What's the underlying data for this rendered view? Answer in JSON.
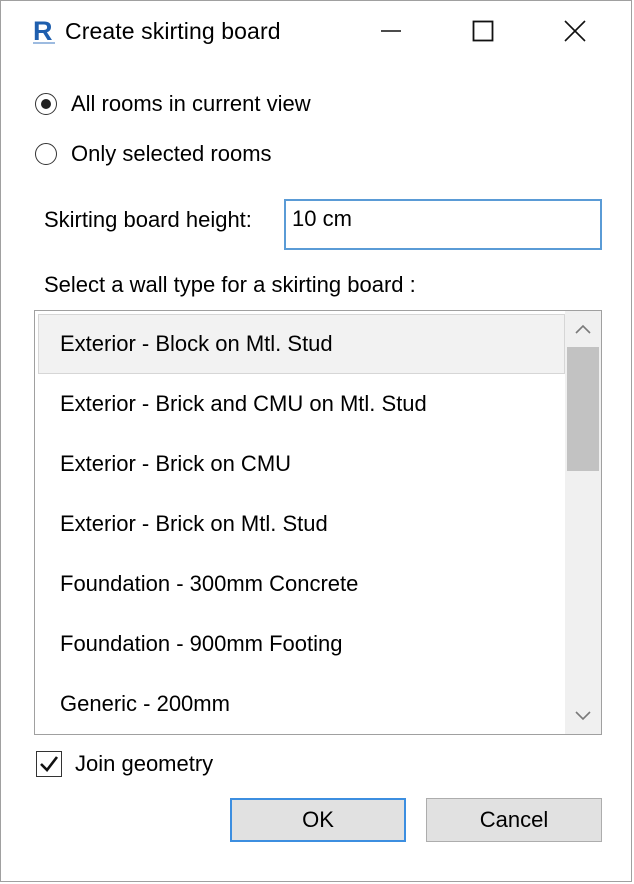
{
  "window": {
    "title": "Create skirting board",
    "app_icon": "revit-R-icon",
    "controls": [
      "minimize-icon",
      "maximize-icon",
      "close-icon"
    ]
  },
  "scope": {
    "options": [
      {
        "label": "All rooms in current view",
        "checked": true
      },
      {
        "label": "Only selected rooms",
        "checked": false
      }
    ]
  },
  "height": {
    "label": "Skirting board height:",
    "value": "10 cm"
  },
  "wall_types": {
    "label": "Select a wall type for a skirting board :",
    "items": [
      "Exterior - Block on Mtl. Stud",
      "Exterior - Brick and CMU on Mtl. Stud",
      "Exterior - Brick on CMU",
      "Exterior - Brick on Mtl. Stud",
      "Foundation - 300mm Concrete",
      "Foundation - 900mm Footing",
      "Generic - 200mm"
    ],
    "selected_index": 0
  },
  "join_geometry": {
    "label": "Join geometry",
    "checked": true
  },
  "buttons": {
    "ok": "OK",
    "cancel": "Cancel"
  },
  "colors": {
    "accent": "#3c8ee0",
    "revit_blue": "#1a5fb4"
  }
}
